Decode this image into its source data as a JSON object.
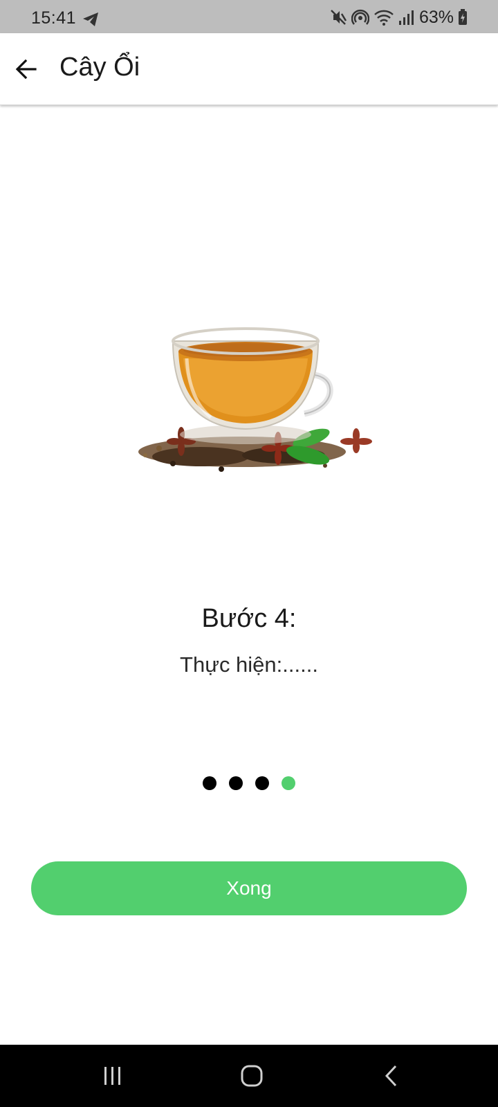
{
  "status_bar": {
    "time": "15:41",
    "left_icon": "telegram-icon",
    "right_icons": [
      "mute-icon",
      "hotspot-icon",
      "wifi-icon",
      "signal-icon"
    ],
    "battery_percent": "63%",
    "battery_icon": "battery-charging-icon"
  },
  "app_bar": {
    "back_icon": "arrow-left-icon",
    "title": "Cây Ổi"
  },
  "step": {
    "image": "tea-cup-with-herbs",
    "title": "Bước 4:",
    "description": "Thực hiện:......",
    "page_count": 4,
    "current_page": 4
  },
  "done_button": {
    "label": "Xong"
  },
  "colors": {
    "accent": "#52cf6e",
    "status_bar_bg": "#bdbdbd",
    "nav_bar_bg": "#000000",
    "text": "#1a1a1a"
  },
  "nav_bar": {
    "items": [
      "recent-apps-icon",
      "home-icon",
      "back-icon"
    ]
  }
}
